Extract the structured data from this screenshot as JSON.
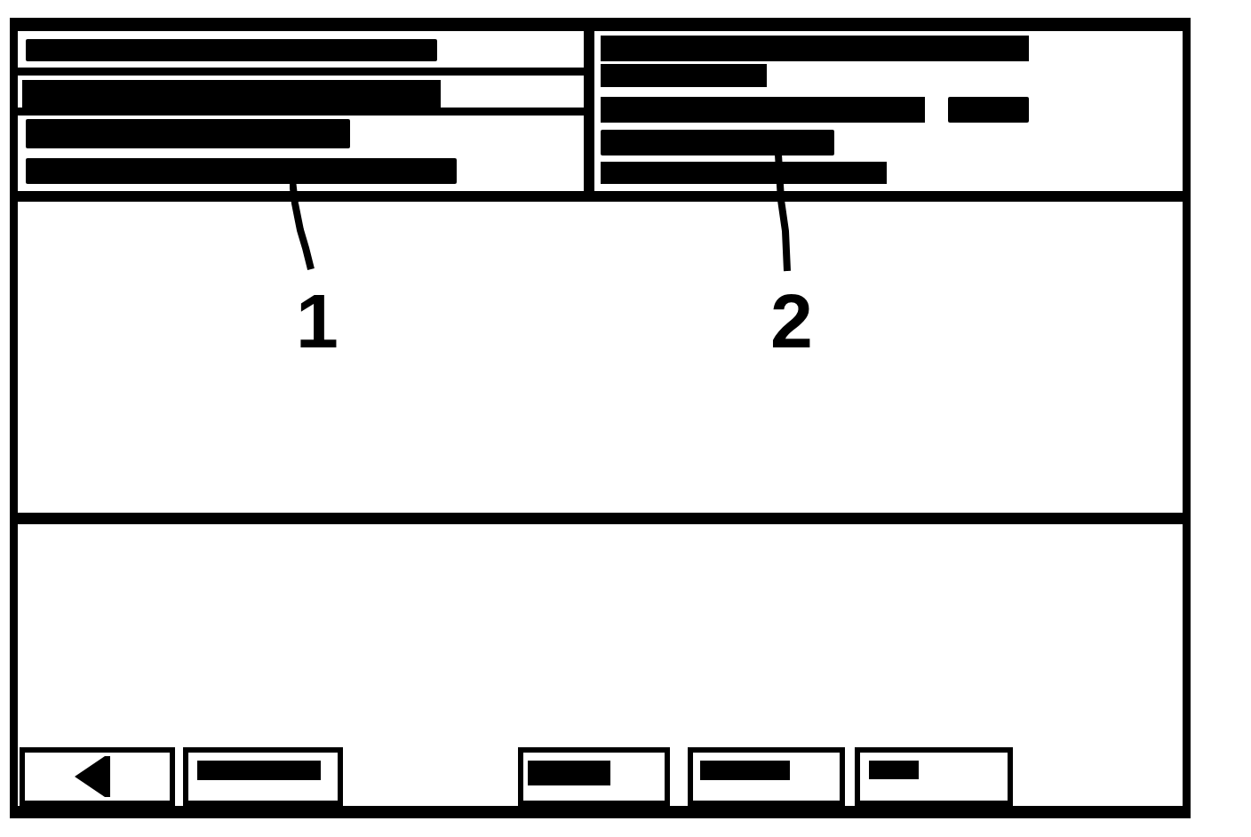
{
  "callouts": [
    {
      "label": "1"
    },
    {
      "label": "2"
    }
  ]
}
